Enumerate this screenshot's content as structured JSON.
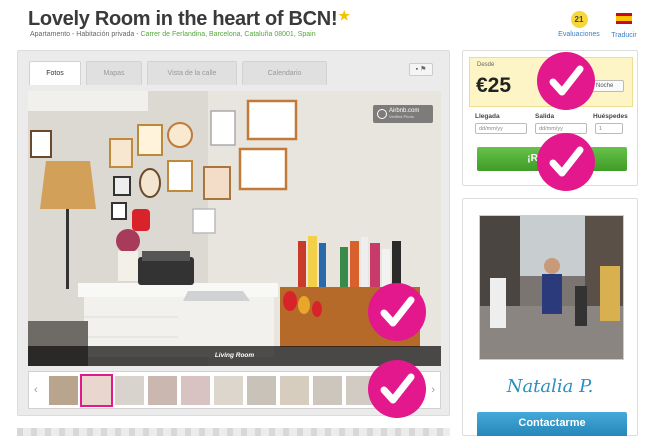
{
  "header": {
    "title": "Lovely Room in the heart of BCN!",
    "room_type": "Apartamento - Habitación privada - ",
    "address": "Carrer de Ferlandina, Barcelona, Cataluña 08001, Spain",
    "reviews_count": "21",
    "reviews_label": "Evaluaciones",
    "translate_label": "Traducir"
  },
  "tabs": [
    {
      "label": "Fotos",
      "active": true
    },
    {
      "label": "Mapas",
      "active": false
    },
    {
      "label": "Vista de la calle",
      "active": false
    },
    {
      "label": "Calendario",
      "active": false
    }
  ],
  "photo": {
    "caption": "Living Room",
    "watermark": "Airbnb.com",
    "watermark_sub": "Verified Photo"
  },
  "thumbnails": {
    "count": 11,
    "selected_index": 1,
    "colors": [
      "#b9a58e",
      "#e8d6cf",
      "#d8d3cc",
      "#c9b7b0",
      "#d9c2c2",
      "#ddd6cc",
      "#c8c2b9",
      "#d6cdbf",
      "#cdc6bd",
      "#d1cbc4",
      "#c8b8a6"
    ]
  },
  "booking": {
    "from_label": "Desde",
    "price": "€25",
    "per_option": "Noche",
    "checkin_label": "Llegada",
    "checkout_label": "Salida",
    "guests_label": "Huéspedes",
    "date_placeholder": "dd/mm/yy",
    "guests_value": "1",
    "reserve_button": "¡Reservar!"
  },
  "host": {
    "name": "Natalia P.",
    "contact_button": "Contactarme"
  },
  "overlay": {
    "check_color": "#e2188c",
    "check_icon": "checkmark-icon"
  }
}
